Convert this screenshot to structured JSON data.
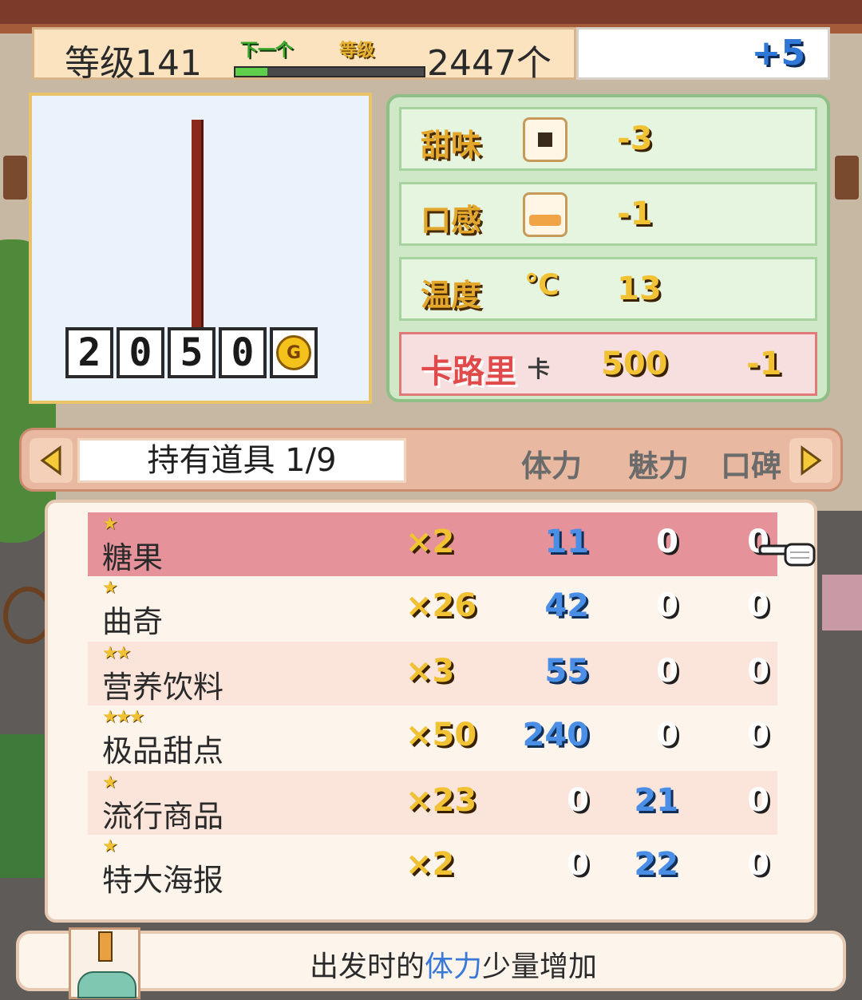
{
  "header": {
    "level_label": "等级141",
    "next_label": "下一个",
    "level_tag": "等级",
    "level_progress": 0.17,
    "count_label": "2447个",
    "bonus": "+5"
  },
  "preview": {
    "price_digits": [
      "2",
      "0",
      "5",
      "0"
    ],
    "currency": "G"
  },
  "attributes": {
    "sweet": {
      "label": "甜味",
      "value": "-3"
    },
    "texture": {
      "label": "口感",
      "value": "-1"
    },
    "temperature": {
      "label": "温度",
      "icon": "℃",
      "value": "13"
    },
    "calories": {
      "label": "卡路里",
      "unit": "卡",
      "value": "500",
      "modifier": "-1"
    }
  },
  "tabs": {
    "title": "持有道具 1/9",
    "columns": [
      "体力",
      "魅力",
      "口碑"
    ]
  },
  "items": [
    {
      "stars": "★",
      "name": "糖果",
      "qty": "×2",
      "stamina": "11",
      "charm": "0",
      "reputation": "0"
    },
    {
      "stars": "★",
      "name": "曲奇",
      "qty": "×26",
      "stamina": "42",
      "charm": "0",
      "reputation": "0"
    },
    {
      "stars": "★★",
      "name": "营养饮料",
      "qty": "×3",
      "stamina": "55",
      "charm": "0",
      "reputation": "0"
    },
    {
      "stars": "★★★",
      "name": "极品甜点",
      "qty": "×50",
      "stamina": "240",
      "charm": "0",
      "reputation": "0"
    },
    {
      "stars": "★",
      "name": "流行商品",
      "qty": "×23",
      "stamina": "0",
      "charm": "21",
      "reputation": "0"
    },
    {
      "stars": "★",
      "name": "特大海报",
      "qty": "×2",
      "stamina": "0",
      "charm": "22",
      "reputation": "0"
    }
  ],
  "description": {
    "prefix": "出发时的",
    "highlight": "体力",
    "suffix": "少量增加"
  }
}
